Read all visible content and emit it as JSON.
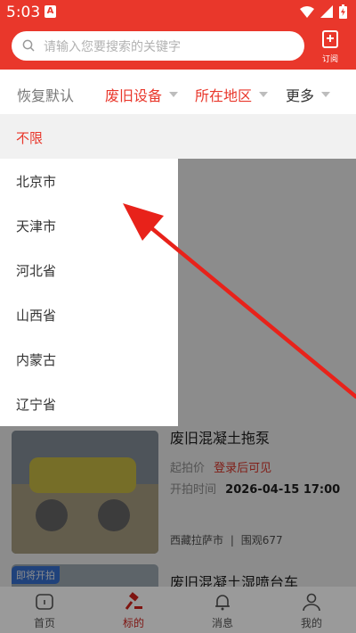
{
  "status_bar": {
    "time": "5:03",
    "sim_badge": "A"
  },
  "search": {
    "placeholder": "请输入您要搜索的关键字",
    "subscribe_label": "订阅"
  },
  "filters": {
    "reset": "恢复默认",
    "category": "废旧设备",
    "region": "所在地区",
    "more": "更多"
  },
  "dropdown": {
    "top_option": "不限",
    "items": [
      "北京市",
      "天津市",
      "河北省",
      "山西省",
      "内蒙古",
      "辽宁省"
    ]
  },
  "listings": [
    {
      "title": "废旧混凝土拖泵",
      "price_label": "起拍价",
      "price_value": "登录后可见",
      "time_label": "开拍时间",
      "time_value": "2026-04-15 17:00",
      "location": "西藏拉萨市",
      "views": "围观677"
    },
    {
      "badge": "即将开拍",
      "title": "废旧混凝土湿喷台车"
    }
  ],
  "tabbar": [
    {
      "label": "首页",
      "icon": "home-icon"
    },
    {
      "label": "标的",
      "icon": "gavel-icon"
    },
    {
      "label": "消息",
      "icon": "bell-icon"
    },
    {
      "label": "我的",
      "icon": "user-icon"
    }
  ],
  "colors": {
    "brand_red": "#e9372b",
    "dropdown_active": "#e9372b",
    "badge_blue": "#3b78e0"
  }
}
